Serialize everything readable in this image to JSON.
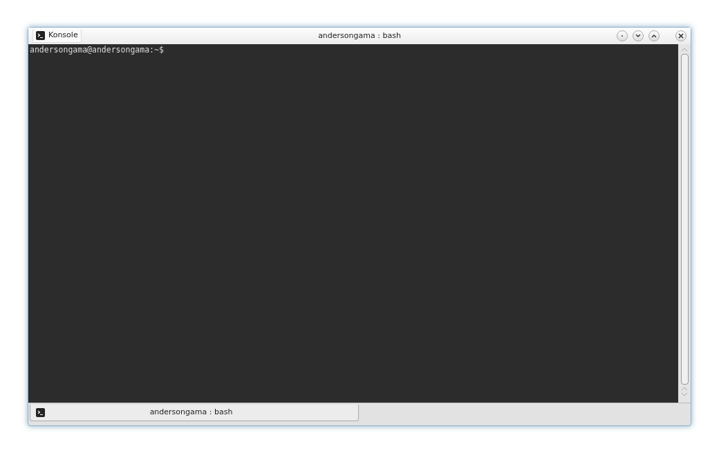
{
  "window": {
    "app_name": "Konsole",
    "title": "andersongama : bash"
  },
  "terminal": {
    "lines": [
      "andersongama@andersongama:~$"
    ]
  },
  "tabs": [
    {
      "label": "andersongama : bash",
      "selected": true
    }
  ]
}
